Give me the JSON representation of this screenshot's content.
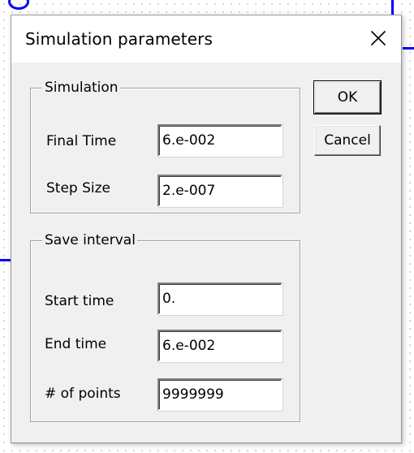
{
  "dialog": {
    "title": "Simulation parameters"
  },
  "simulation_group": {
    "legend": "Simulation",
    "final_time_label": "Final Time",
    "final_time_value": "6.e-002",
    "step_size_label": "Step Size",
    "step_size_value": "2.e-007"
  },
  "save_group": {
    "legend": "Save interval",
    "start_time_label": "Start time",
    "start_time_value": "0.",
    "end_time_label": "End time",
    "end_time_value": "6.e-002",
    "points_label": "# of points",
    "points_value": "9999999"
  },
  "buttons": {
    "ok_label": "OK",
    "cancel_label": "Cancel"
  },
  "icons": {
    "close": "close-icon"
  },
  "colors": {
    "schematic_wire": "#0000ff",
    "dialog_background": "#f0f0f0"
  }
}
